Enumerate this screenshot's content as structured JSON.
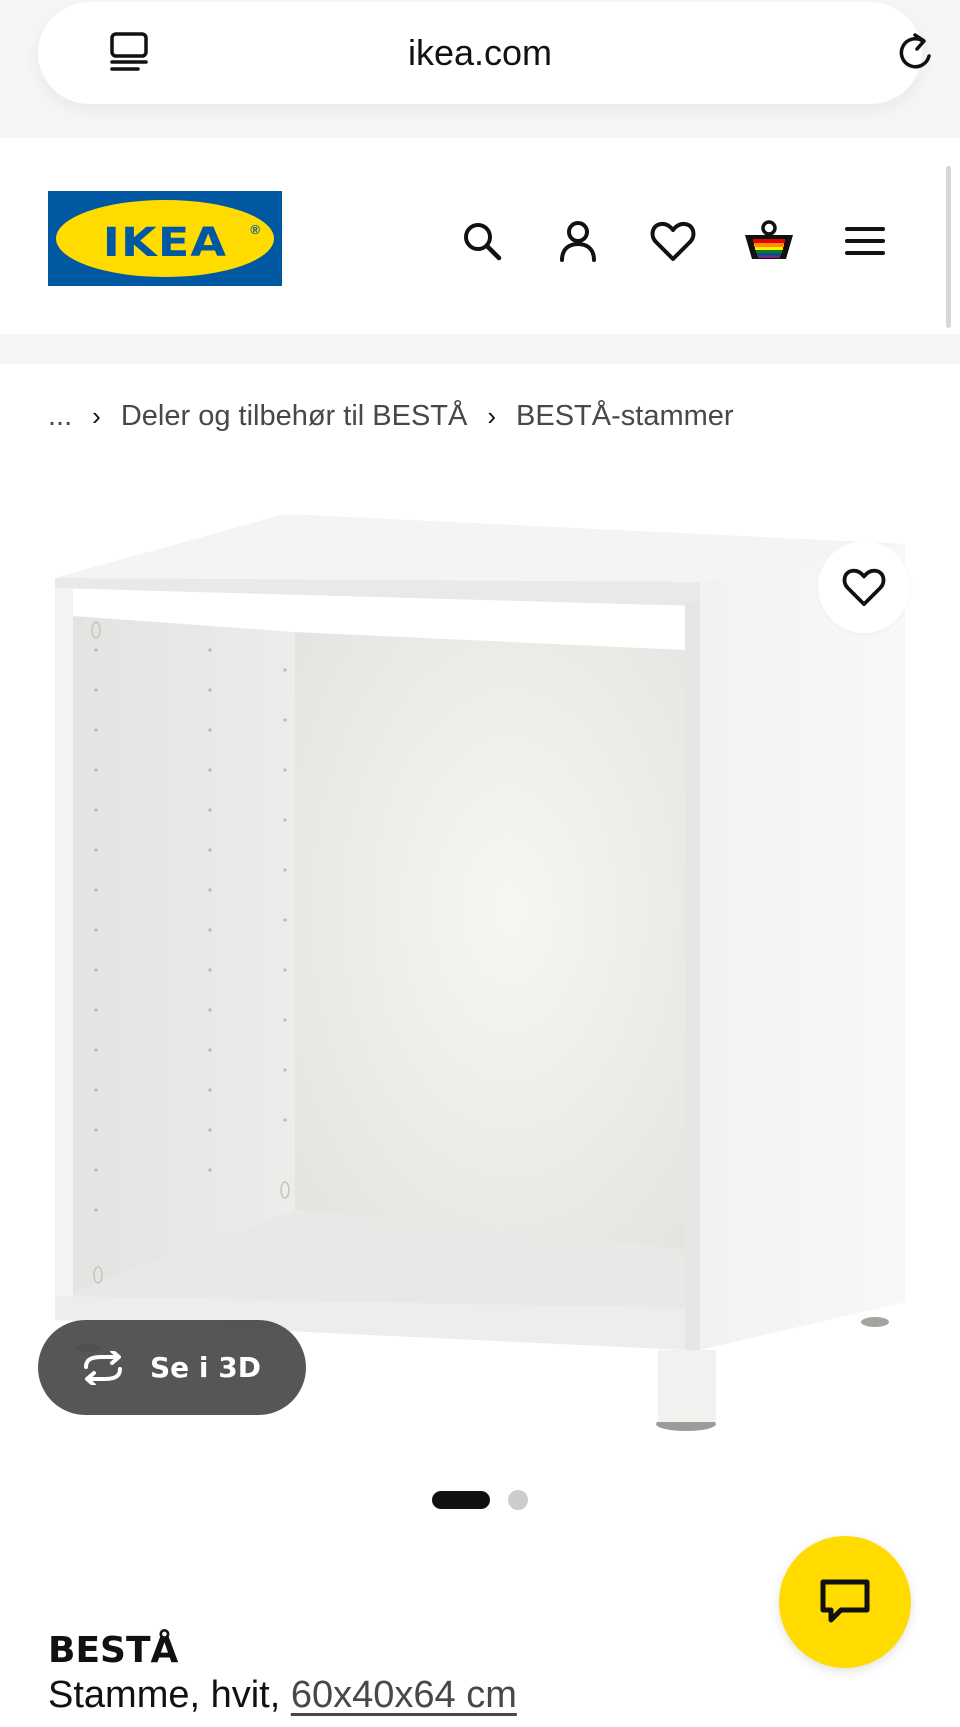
{
  "browser": {
    "url": "ikea.com",
    "tabs_icon": "tabs-icon",
    "reload_icon": "reload-icon"
  },
  "header": {
    "logo_text": "IKEA",
    "logo_colors": {
      "blue": "#0058a3",
      "yellow": "#ffdb00"
    },
    "icons": [
      "search-icon",
      "account-icon",
      "heart-icon",
      "basket-icon",
      "menu-icon"
    ]
  },
  "breadcrumb": {
    "items": [
      "...",
      "Deler og tilbehør til BESTÅ",
      "BESTÅ-stammer"
    ],
    "separator": "›"
  },
  "gallery": {
    "view_3d_label": "Se i 3D",
    "total_images": 2,
    "active_image_index": 0,
    "favorite_icon": "heart-icon"
  },
  "product": {
    "name": "BESTÅ",
    "description": "Stamme, hvit, ",
    "size": "60x40x64 cm"
  },
  "chat": {
    "icon": "chat-icon",
    "color": "#ffdb00"
  }
}
